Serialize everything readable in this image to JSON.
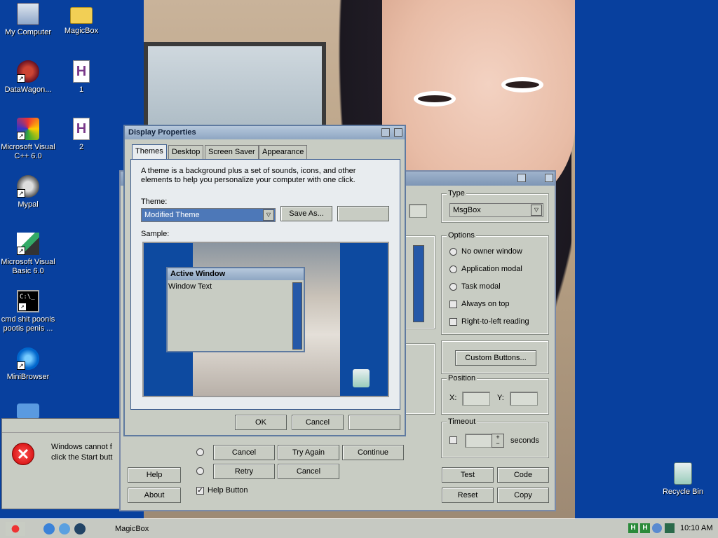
{
  "desktop": {
    "icons": [
      {
        "name": "my-computer-icon",
        "label": "My Computer"
      },
      {
        "name": "magicbox-folder-icon",
        "label": "MagicBox"
      },
      {
        "name": "datawagon-icon",
        "label": "DataWagon..."
      },
      {
        "name": "h-file-icon",
        "label": "1"
      },
      {
        "name": "visual-cpp-icon",
        "label": "Microsoft Visual C++ 6.0"
      },
      {
        "name": "h-file-icon",
        "label": "2"
      },
      {
        "name": "mypal-icon",
        "label": "Mypal"
      },
      {
        "name": "visual-basic-icon",
        "label": "Microsoft Visual Basic 6.0"
      },
      {
        "name": "cmd-icon",
        "label": "cmd shit poonis pootis penis ..."
      },
      {
        "name": "minibrowser-icon",
        "label": "MiniBrowser"
      },
      {
        "name": "recycle-bin-icon",
        "label": "Recycle Bin"
      }
    ]
  },
  "display_properties": {
    "title": "Display Properties",
    "tabs": [
      "Themes",
      "Desktop",
      "Screen Saver",
      "Appearance"
    ],
    "description": "A theme is a background plus a set of sounds, icons, and other elements to help you personalize your computer with one click.",
    "theme_label": "Theme:",
    "theme_value": "Modified Theme",
    "save_as": "Save As...",
    "sample_label": "Sample:",
    "active_window_title": "Active Window",
    "window_text": "Window Text",
    "ok": "OK",
    "cancel": "Cancel"
  },
  "magicbox": {
    "type_legend": "Type",
    "type_value": "MsgBox",
    "options_legend": "Options",
    "options": [
      {
        "label": "No owner window",
        "kind": "radio"
      },
      {
        "label": "Application modal",
        "kind": "radio"
      },
      {
        "label": "Task modal",
        "kind": "radio"
      },
      {
        "label": "Always on top",
        "kind": "check"
      },
      {
        "label": "Right-to-left reading",
        "kind": "check"
      }
    ],
    "custom_buttons": "Custom Buttons...",
    "position_legend": "Position",
    "x_label": "X:",
    "y_label": "Y:",
    "timeout_legend": "Timeout",
    "seconds": "seconds",
    "test": "Test",
    "code": "Code",
    "reset": "Reset",
    "copy": "Copy",
    "help": "Help",
    "about": "About",
    "help_button_label": "Help Button",
    "button_row1": [
      "Cancel",
      "Try Again",
      "Continue"
    ],
    "button_row2": [
      "Retry",
      "Cancel"
    ]
  },
  "error_dialog": {
    "line1": "Windows cannot f",
    "line2": "click the Start butt"
  },
  "taskbar": {
    "task_label": "MagicBox",
    "clock": "10:10 AM"
  }
}
